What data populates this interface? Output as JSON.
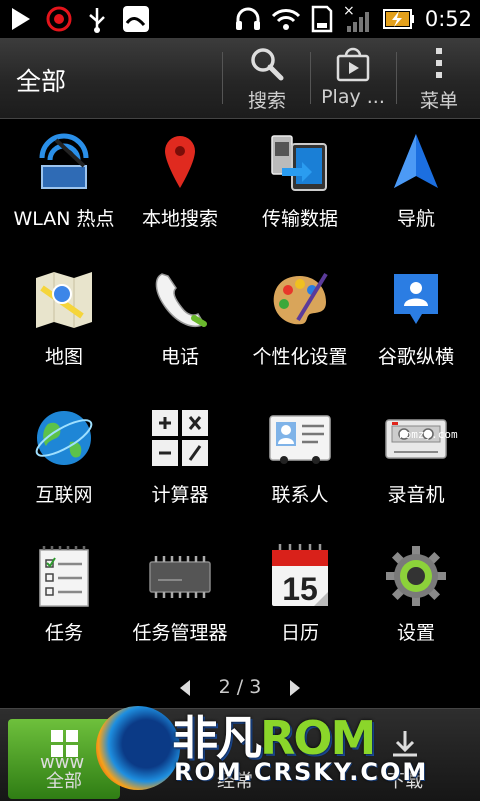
{
  "status_bar": {
    "time": "0:52",
    "icons": [
      "play-icon",
      "beats-icon",
      "usb-icon",
      "mail-icon",
      "headphones-icon",
      "wifi-icon",
      "sd-card-icon",
      "signal-icon",
      "battery-charging-icon"
    ]
  },
  "action_bar": {
    "title": "全部",
    "search_label": "搜索",
    "play_label": "Play ...",
    "menu_label": "菜单"
  },
  "apps": [
    {
      "label": "WLAN 热点",
      "icon": "wlan-hotspot-icon"
    },
    {
      "label": "本地搜索",
      "icon": "local-search-icon"
    },
    {
      "label": "传输数据",
      "icon": "transfer-data-icon"
    },
    {
      "label": "导航",
      "icon": "navigation-icon"
    },
    {
      "label": "地图",
      "icon": "maps-icon"
    },
    {
      "label": "电话",
      "icon": "phone-icon"
    },
    {
      "label": "个性化设置",
      "icon": "personalize-icon"
    },
    {
      "label": "谷歌纵横",
      "icon": "latitude-icon"
    },
    {
      "label": "互联网",
      "icon": "internet-icon"
    },
    {
      "label": "计算器",
      "icon": "calculator-icon"
    },
    {
      "label": "联系人",
      "icon": "contacts-icon"
    },
    {
      "label": "录音机",
      "icon": "recorder-icon"
    },
    {
      "label": "任务",
      "icon": "tasks-icon"
    },
    {
      "label": "任务管理器",
      "icon": "task-manager-icon"
    },
    {
      "label": "日历",
      "icon": "calendar-icon"
    },
    {
      "label": "设置",
      "icon": "settings-icon"
    }
  ],
  "calendar_day": "15",
  "pager": {
    "text": "2 / 3"
  },
  "bottom_tabs": [
    {
      "label": "全部"
    },
    {
      "label": "经常"
    },
    {
      "label": "下载"
    }
  ],
  "overlay_text": "romzj.com",
  "watermark": {
    "brand_cn": "非凡",
    "brand_rom": "ROM",
    "url": "ROM.CRSKY.COM",
    "side": "www"
  }
}
